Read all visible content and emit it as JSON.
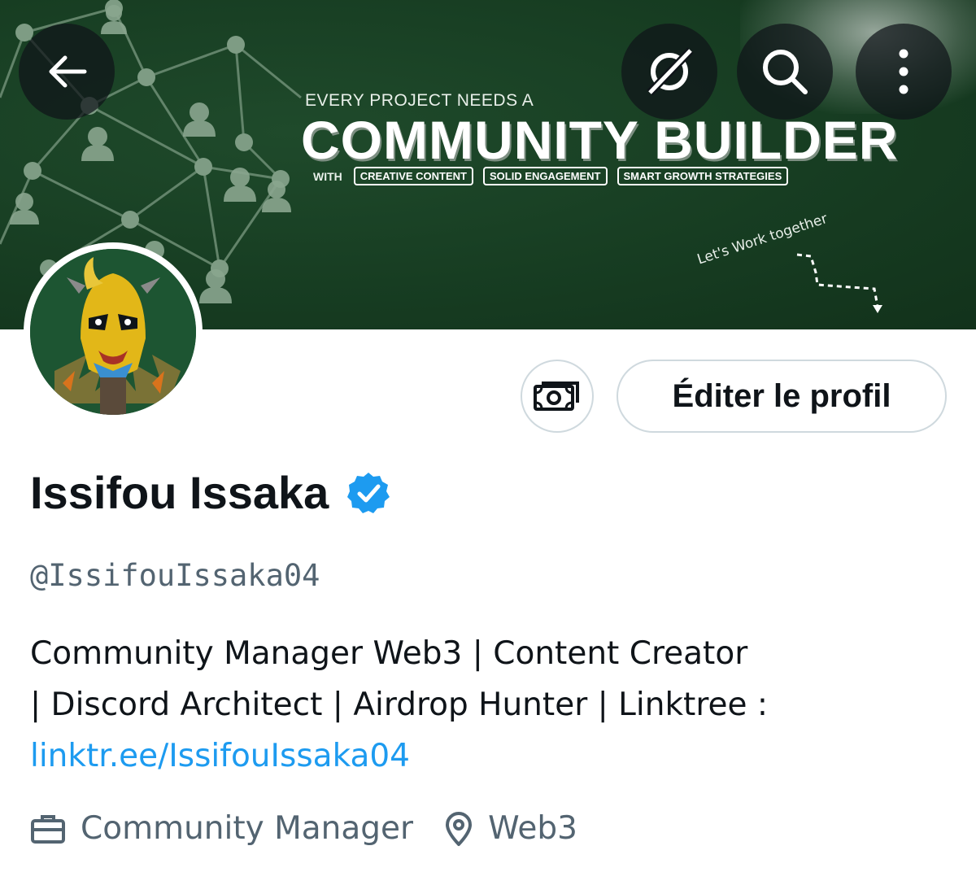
{
  "header": {
    "back_icon": "arrow-left-icon",
    "grok_icon": "grok-icon",
    "search_icon": "search-icon",
    "more_icon": "more-vertical-icon"
  },
  "banner": {
    "tagline": "EVERY PROJECT NEEDS A",
    "headline": "COMMUNITY BUILDER",
    "with_label": "WITH",
    "pills": [
      "CREATIVE CONTENT",
      "SOLID ENGAGEMENT",
      "SMART GROWTH STRATEGIES"
    ],
    "handwritten": "Let's Work together",
    "background_color": "#173d22"
  },
  "profile": {
    "name": "Issifou Issaka",
    "verified_icon": "verified-badge-icon",
    "handle": "@IssifouIssaka04",
    "bio_lines": [
      "Community Manager Web3 | Content Creator",
      "| Discord Architect | Airdrop Hunter | Linktree :"
    ],
    "bio_link": "linktr.ee/IssifouIssaka04",
    "profession_icon": "briefcase-icon",
    "profession": "Community Manager",
    "location_icon": "location-pin-icon",
    "location": "Web3"
  },
  "actions": {
    "monetization_icon": "money-icon",
    "edit_label": "Éditer le profil"
  },
  "colors": {
    "link": "#1d9bf0",
    "verified": "#1d9bf0",
    "secondary_text": "#536471",
    "button_border": "#cfd9de"
  }
}
